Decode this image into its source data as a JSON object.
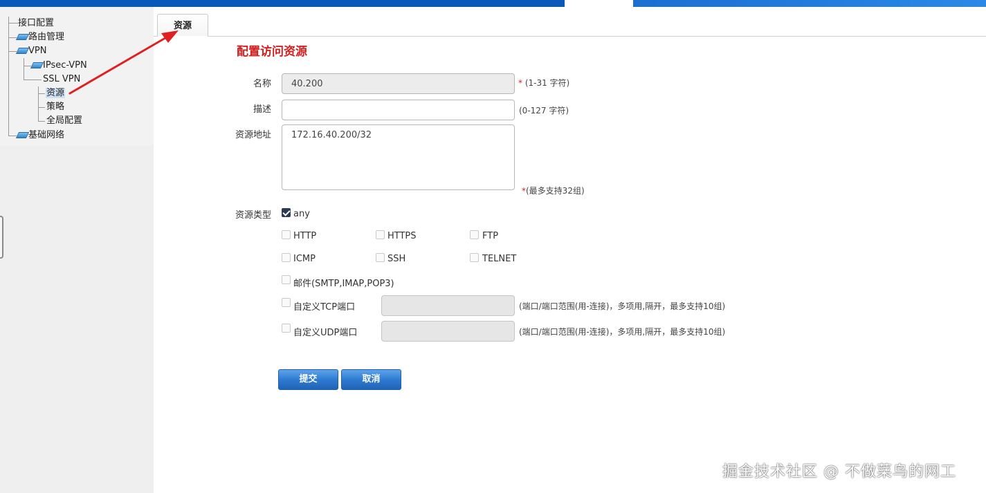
{
  "tree": {
    "interface_config": "接口配置",
    "route_mgmt": "路由管理",
    "vpn": "VPN",
    "ipsec_vpn": "IPsec-VPN",
    "ssl_vpn": "SSL VPN",
    "resource": "资源",
    "policy": "策略",
    "global_config": "全局配置",
    "basic_network": "基础网络"
  },
  "tab": {
    "label": "资源"
  },
  "form": {
    "title": "配置访问资源",
    "name": {
      "label": "名称",
      "value": "40.200",
      "required_mark": "*",
      "hint": "(1-31 字符)"
    },
    "description": {
      "label": "描述",
      "value": "",
      "hint": "(0-127 字符)"
    },
    "address": {
      "label": "资源地址",
      "value": "172.16.40.200/32",
      "required_mark": "*",
      "hint": "(最多支持32组)"
    },
    "type": {
      "label": "资源类型",
      "any": {
        "label": "any",
        "checked": true
      },
      "http": {
        "label": "HTTP",
        "checked": false
      },
      "https": {
        "label": "HTTPS",
        "checked": false
      },
      "ftp": {
        "label": "FTP",
        "checked": false
      },
      "icmp": {
        "label": "ICMP",
        "checked": false
      },
      "ssh": {
        "label": "SSH",
        "checked": false
      },
      "telnet": {
        "label": "TELNET",
        "checked": false
      },
      "mail": {
        "label": "邮件(SMTP,IMAP,POP3)",
        "checked": false
      },
      "tcp": {
        "label": "自定义TCP端口",
        "checked": false,
        "value": "",
        "hint": "(端口/端口范围(用-连接)，多项用,隔开，最多支持10组)"
      },
      "udp": {
        "label": "自定义UDP端口",
        "checked": false,
        "value": "",
        "hint": "(端口/端口范围(用-连接)，多项用,隔开，最多支持10组)"
      }
    },
    "submit_label": "提交",
    "cancel_label": "取消"
  },
  "watermark": "掘金技术社区 @ 不做菜鸟的网工",
  "colors": {
    "title_red": "#d01f1f",
    "button_blue": "#2f7bd2",
    "top_bar": "#0a58b8",
    "arrow": "#e02020"
  }
}
